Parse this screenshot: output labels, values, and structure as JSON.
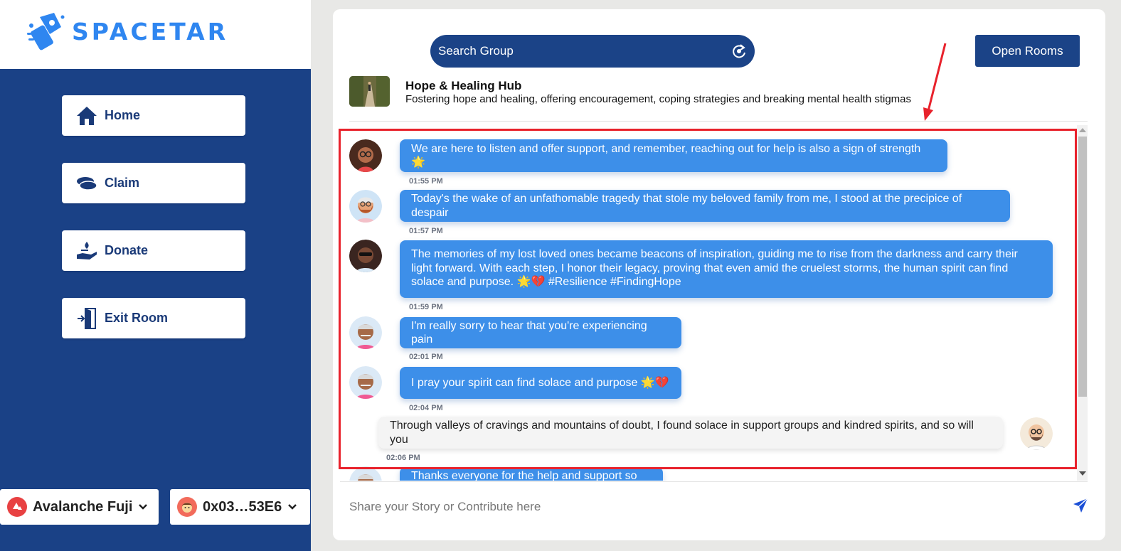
{
  "brand": {
    "name": "SPACETAR",
    "accent": "#2f86f0",
    "sidebar_color": "#1a4186"
  },
  "nav": [
    {
      "label": "Home",
      "icon": "home-icon"
    },
    {
      "label": "Claim",
      "icon": "coins-icon"
    },
    {
      "label": "Donate",
      "icon": "donate-hand-icon"
    },
    {
      "label": "Exit Room",
      "icon": "exit-door-icon"
    }
  ],
  "network": {
    "label": "Avalanche Fuji",
    "icon": "avalanche-icon"
  },
  "account": {
    "label": "0x03…53E6",
    "icon": "account-avatar-icon"
  },
  "search": {
    "label": "Search Group",
    "icon": "refresh-icon"
  },
  "open_rooms_label": "Open Rooms",
  "group": {
    "title": "Hope & Healing Hub",
    "description": "Fostering hope and healing, offering encouragement, coping strategies and breaking mental health stigmas"
  },
  "messages": [
    {
      "text": "We are here to listen and offer support, and remember, reaching out for help is also a sign of strength 🌟",
      "time": "01:55 PM",
      "avatar": "woman-glasses-avatar",
      "mine": false
    },
    {
      "text": "Today's the wake of an unfathomable tragedy that stole my beloved family from me, I stood at the precipice of despair",
      "time": "01:57 PM",
      "avatar": "bearded-man-avatar",
      "mine": false
    },
    {
      "text": "The memories of my lost loved ones became beacons of inspiration, guiding me to rise from the darkness and carry their light forward. With each step, I honor their legacy, proving that even amid the cruelest storms, the human spirit can find solace and purpose. 🌟💔 #Resilience #FindingHope",
      "time": "01:59 PM",
      "avatar": "woman-sunglasses-avatar",
      "mine": false
    },
    {
      "text": "I'm really sorry to hear that you're experiencing pain",
      "time": "02:01 PM",
      "avatar": "elder-man-avatar",
      "mine": false
    },
    {
      "text": "I pray your spirit can find solace and purpose 🌟💔",
      "time": "02:04 PM",
      "avatar": "elder-man-avatar",
      "mine": false
    },
    {
      "text": "Through valleys of cravings and mountains of doubt, I found solace in support groups and kindred spirits, and so will you",
      "time": "02:06 PM",
      "avatar": "bald-glasses-man-avatar",
      "mine": true
    },
    {
      "text": "Thanks everyone for the help and support so far",
      "time": "",
      "avatar": "elder-man-avatar",
      "mine": false
    }
  ],
  "compose": {
    "placeholder": "Share your Story or Contribute here",
    "send_icon": "send-icon"
  },
  "annotation": {
    "color": "#e8222c"
  }
}
